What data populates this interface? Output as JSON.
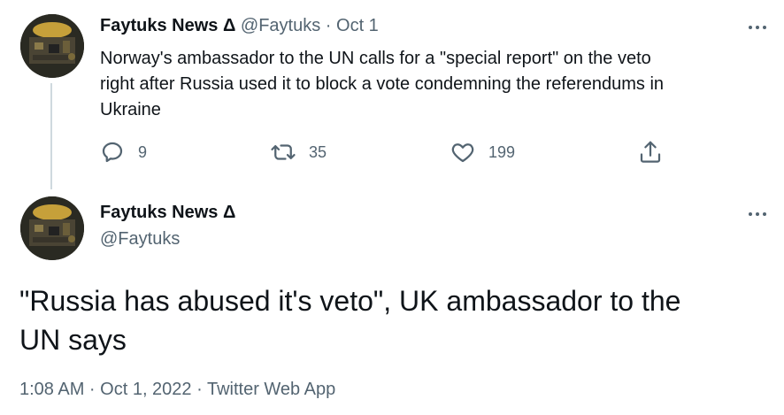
{
  "tweet1": {
    "author_name": "Faytuks News Δ",
    "author_handle": "@Faytuks",
    "separator": "·",
    "date": "Oct 1",
    "text_lines": [
      "Norway's ambassador to the UN calls for a \"special report\" on the veto",
      "right after Russia used it to block a vote condemning the referendums in",
      "Ukraine"
    ],
    "replies": "9",
    "retweets": "35",
    "likes": "199"
  },
  "tweet2": {
    "author_name": "Faytuks News Δ",
    "author_handle": "@Faytuks",
    "text_lines": [
      "\"Russia has abused it's veto\", UK ambassador to the",
      "UN says"
    ],
    "meta": "1:08 AM · Oct 1, 2022 · Twitter Web App"
  },
  "icons": {
    "more": "more-horizontal-icon",
    "reply": "reply-icon",
    "retweet": "retweet-icon",
    "like": "heart-icon",
    "share": "share-icon"
  },
  "colors": {
    "text": "#0f1419",
    "muted": "#536471",
    "thread_line": "#cfd9de"
  }
}
